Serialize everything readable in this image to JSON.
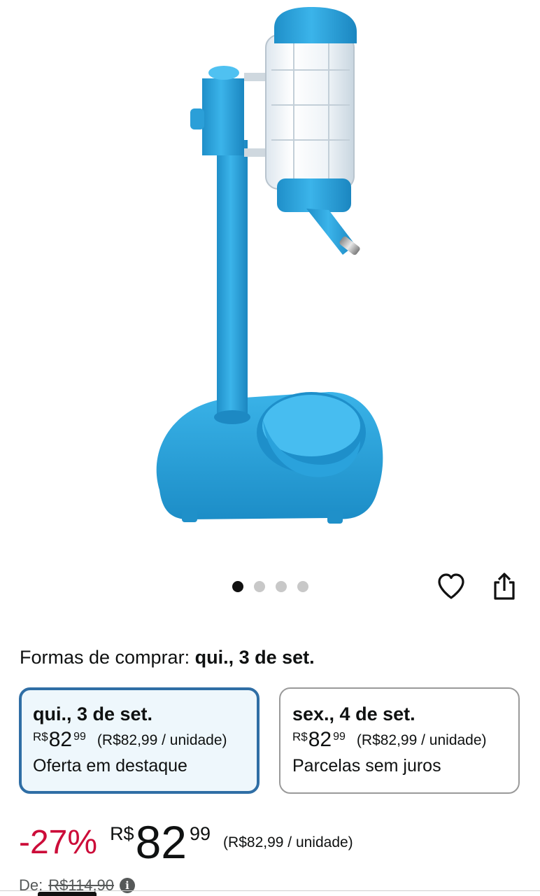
{
  "product": {
    "image_icon": "pet-water-dispenser-image"
  },
  "carousel": {
    "dot_count": 4,
    "active_index": 0
  },
  "actions": {
    "favorite_icon": "heart-icon",
    "share_icon": "share-icon"
  },
  "buying": {
    "label": "Formas de comprar:",
    "date": "qui., 3 de set.",
    "options": [
      {
        "date": "qui., 3 de set.",
        "currency": "R$",
        "whole": "82",
        "fraction": "99",
        "unit_price": "(R$82,99 / unidade)",
        "note": "Oferta em destaque",
        "selected": true
      },
      {
        "date": "sex., 4 de set.",
        "currency": "R$",
        "whole": "82",
        "fraction": "99",
        "unit_price": "(R$82,99 / unidade)",
        "note": "Parcelas sem juros",
        "selected": false
      }
    ]
  },
  "price": {
    "discount": "-27%",
    "currency": "R$",
    "whole": "82",
    "fraction": "99",
    "unit_price": "(R$82,99 / unidade)",
    "list_label": "De:",
    "list_price": "R$114,90"
  },
  "colors": {
    "accent_selected_border": "#2f6ea5",
    "selected_bg": "#eef7fc",
    "discount": "#cc0c39",
    "product_blue": "#29a3db"
  }
}
